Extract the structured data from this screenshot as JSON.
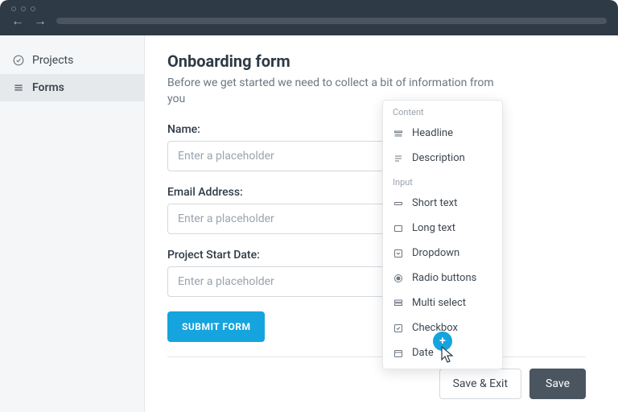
{
  "sidebar": {
    "items": [
      {
        "label": "Projects"
      },
      {
        "label": "Forms"
      }
    ]
  },
  "form": {
    "title": "Onboarding form",
    "description": "Before we get started we need to collect a bit of information from you",
    "fields": [
      {
        "label": "Name:",
        "placeholder": "Enter a placeholder"
      },
      {
        "label": "Email Address:",
        "placeholder": "Enter a placeholder"
      },
      {
        "label": "Project Start Date:",
        "placeholder": "Enter a placeholder"
      }
    ],
    "submit_label": "SUBMIT FORM"
  },
  "footer": {
    "save_exit": "Save & Exit",
    "save": "Save"
  },
  "popover": {
    "sections": [
      {
        "heading": "Content",
        "items": [
          {
            "label": "Headline"
          },
          {
            "label": "Description"
          }
        ]
      },
      {
        "heading": "Input",
        "items": [
          {
            "label": "Short text"
          },
          {
            "label": "Long text"
          },
          {
            "label": "Dropdown"
          },
          {
            "label": "Radio buttons"
          },
          {
            "label": "Multi select"
          },
          {
            "label": "Checkbox"
          },
          {
            "label": "Date"
          }
        ]
      }
    ]
  },
  "fab": {
    "label": "+"
  }
}
